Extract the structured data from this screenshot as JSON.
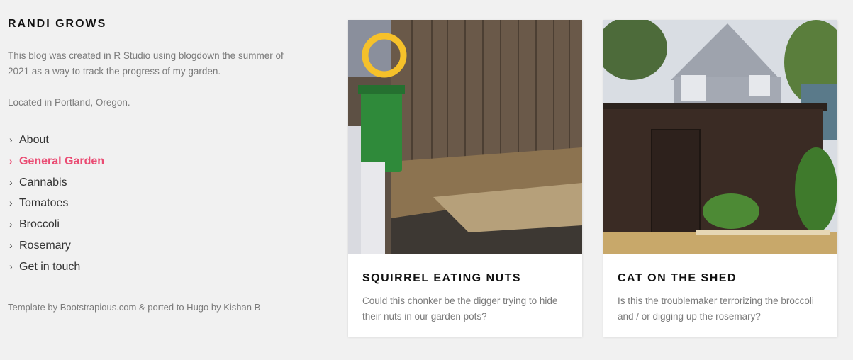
{
  "site": {
    "title": "RANDI GROWS",
    "description": "This blog was created in R Studio using blogdown the summer of 2021 as a way to track the progress of my garden.",
    "location": "Located in Portland, Oregon."
  },
  "nav": {
    "items": [
      {
        "label": "About"
      },
      {
        "label": "General Garden",
        "active": true
      },
      {
        "label": "Cannabis"
      },
      {
        "label": "Tomatoes"
      },
      {
        "label": "Broccoli"
      },
      {
        "label": "Rosemary"
      },
      {
        "label": "Get in touch"
      }
    ],
    "chevron_icon": "chevron-right-icon",
    "active_color": "#ea4c73"
  },
  "footer": {
    "credit": "Template by Bootstrapious.com & ported to Hugo by Kishan B"
  },
  "posts": [
    {
      "title": "SQUIRREL EATING NUTS",
      "excerpt": "Could this chonker be the digger trying to hide their nuts in our garden pots?"
    },
    {
      "title": "CAT ON THE SHED",
      "excerpt": "Is this the troublemaker terrorizing the broccoli and / or digging up the rosemary?"
    }
  ]
}
